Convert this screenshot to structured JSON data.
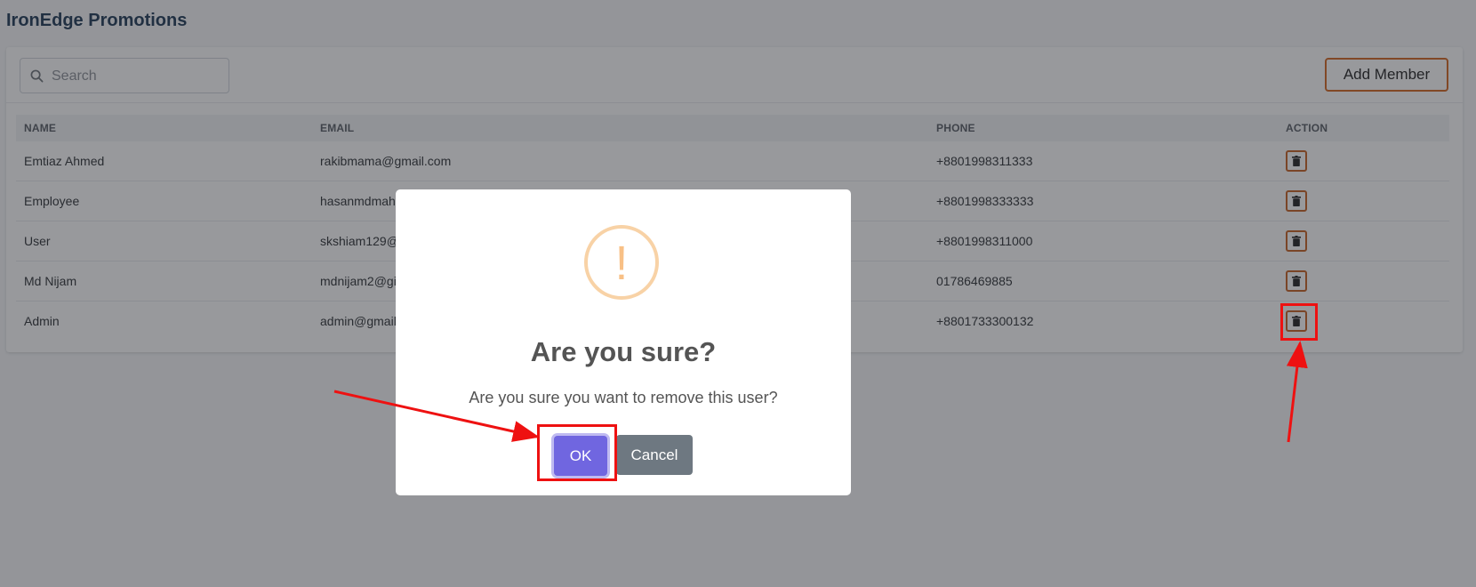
{
  "app": {
    "title": "IronEdge Promotions"
  },
  "toolbar": {
    "search_placeholder": "Search",
    "add_member_label": "Add Member"
  },
  "table": {
    "headers": {
      "name": "NAME",
      "email": "EMAIL",
      "phone": "PHONE",
      "action": "ACTION"
    },
    "rows": [
      {
        "name": "Emtiaz Ahmed",
        "email": "rakibmama@gmail.com",
        "phone": "+8801998311333"
      },
      {
        "name": "Employee",
        "email": "hasanmdmah",
        "phone": "+8801998333333"
      },
      {
        "name": "User",
        "email": "skshiam129@",
        "phone": "+8801998311000"
      },
      {
        "name": "Md Nijam",
        "email": "mdnijam2@gi",
        "phone": "01786469885"
      },
      {
        "name": "Admin",
        "email": "admin@gmail",
        "phone": "+8801733300132"
      }
    ]
  },
  "dialog": {
    "icon": "exclamation-icon",
    "icon_mark": "!",
    "title": "Are you sure?",
    "text": "Are you sure you want to remove this user?",
    "ok_label": "OK",
    "cancel_label": "Cancel"
  },
  "colors": {
    "brand_title": "#1b3654",
    "accent_orange": "#d4651e",
    "ok_button": "#7066e0",
    "cancel_button": "#6e7881",
    "warning_ring": "#f8d2a6",
    "annotation_red": "#ee1111"
  }
}
